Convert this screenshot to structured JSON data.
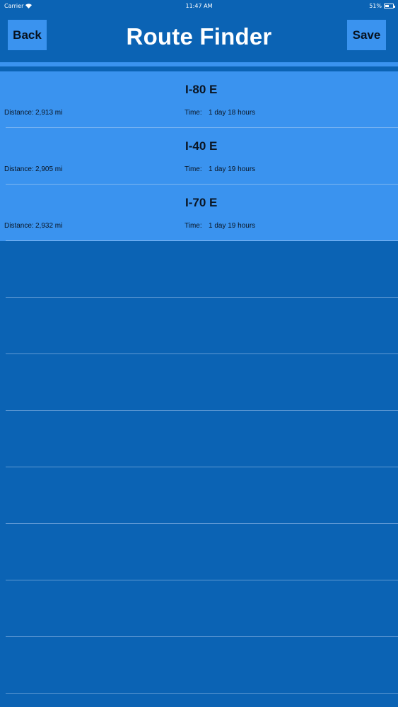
{
  "status_bar": {
    "carrier": "Carrier",
    "time": "11:47 AM",
    "battery_percent_text": "51%",
    "battery_level": 0.51
  },
  "nav": {
    "title": "Route Finder",
    "back_label": "Back",
    "save_label": "Save"
  },
  "routes": [
    {
      "name": "I-80 E",
      "distance_label": "Distance:",
      "distance": "2,913 mi",
      "time_label": "Time:",
      "time": "1 day 18 hours"
    },
    {
      "name": "I-40 E",
      "distance_label": "Distance:",
      "distance": "2,905 mi",
      "time_label": "Time:",
      "time": "1 day 19 hours"
    },
    {
      "name": "I-70 E",
      "distance_label": "Distance:",
      "distance": "2,932 mi",
      "time_label": "Time:",
      "time": "1 day 19 hours"
    }
  ],
  "colors": {
    "background": "#0b63b4",
    "accent": "#3a93ef",
    "title_text": "#ffffff"
  }
}
